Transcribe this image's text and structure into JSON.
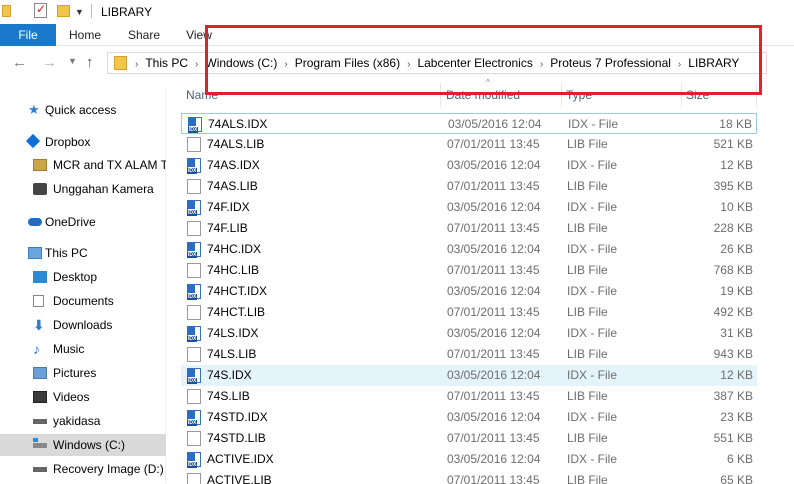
{
  "window": {
    "title": "LIBRARY",
    "quick_access_toolbar": [
      "folder-icon",
      "properties-icon",
      "new-folder-icon",
      "customize-dropdown"
    ]
  },
  "ribbon": {
    "tabs": [
      {
        "label": "File",
        "active": true
      },
      {
        "label": "Home"
      },
      {
        "label": "Share"
      },
      {
        "label": "View"
      }
    ]
  },
  "address_bar": {
    "breadcrumbs": [
      "This PC",
      "Windows (C:)",
      "Program Files (x86)",
      "Labcenter Electronics",
      "Proteus 7 Professional",
      "LIBRARY"
    ],
    "separator": "›"
  },
  "annotation": {
    "color": "#e0202a"
  },
  "nav_pane": {
    "items": [
      {
        "label": "Quick access",
        "icon": "star-icon",
        "indent": 1
      },
      {
        "label": "Dropbox",
        "icon": "dropbox-icon",
        "indent": 1
      },
      {
        "label": "MCR and TX ALAM T",
        "icon": "folder-image-icon",
        "indent": 2
      },
      {
        "label": "Unggahan Kamera",
        "icon": "camera-icon",
        "indent": 2
      },
      {
        "label": "OneDrive",
        "icon": "cloud-icon",
        "indent": 1
      },
      {
        "label": "This PC",
        "icon": "pc-icon",
        "indent": 1
      },
      {
        "label": "Desktop",
        "icon": "desktop-icon",
        "indent": 2
      },
      {
        "label": "Documents",
        "icon": "documents-icon",
        "indent": 2
      },
      {
        "label": "Downloads",
        "icon": "downloads-icon",
        "indent": 2
      },
      {
        "label": "Music",
        "icon": "music-icon",
        "indent": 2
      },
      {
        "label": "Pictures",
        "icon": "pictures-icon",
        "indent": 2
      },
      {
        "label": "Videos",
        "icon": "videos-icon",
        "indent": 2
      },
      {
        "label": "yakidasa",
        "icon": "drive-icon",
        "indent": 2
      },
      {
        "label": "Windows (C:)",
        "icon": "windows-drive-icon",
        "indent": 2,
        "selected": true
      },
      {
        "label": "Recovery Image (D:)",
        "icon": "drive-icon",
        "indent": 2
      }
    ]
  },
  "columns": {
    "name": "Name",
    "date": "Date modified",
    "type": "Type",
    "size": "Size"
  },
  "files": [
    {
      "name": "74ALS.IDX",
      "date": "03/05/2016 12:04",
      "type": "IDX - File",
      "size": "18 KB",
      "kind": "idx",
      "state": "focus"
    },
    {
      "name": "74ALS.LIB",
      "date": "07/01/2011 13:45",
      "type": "LIB File",
      "size": "521 KB",
      "kind": "lib"
    },
    {
      "name": "74AS.IDX",
      "date": "03/05/2016 12:04",
      "type": "IDX - File",
      "size": "12 KB",
      "kind": "idx"
    },
    {
      "name": "74AS.LIB",
      "date": "07/01/2011 13:45",
      "type": "LIB File",
      "size": "395 KB",
      "kind": "lib"
    },
    {
      "name": "74F.IDX",
      "date": "03/05/2016 12:04",
      "type": "IDX - File",
      "size": "10 KB",
      "kind": "idx"
    },
    {
      "name": "74F.LIB",
      "date": "07/01/2011 13:45",
      "type": "LIB File",
      "size": "228 KB",
      "kind": "lib"
    },
    {
      "name": "74HC.IDX",
      "date": "03/05/2016 12:04",
      "type": "IDX - File",
      "size": "26 KB",
      "kind": "idx"
    },
    {
      "name": "74HC.LIB",
      "date": "07/01/2011 13:45",
      "type": "LIB File",
      "size": "768 KB",
      "kind": "lib"
    },
    {
      "name": "74HCT.IDX",
      "date": "03/05/2016 12:04",
      "type": "IDX - File",
      "size": "19 KB",
      "kind": "idx"
    },
    {
      "name": "74HCT.LIB",
      "date": "07/01/2011 13:45",
      "type": "LIB File",
      "size": "492 KB",
      "kind": "lib"
    },
    {
      "name": "74LS.IDX",
      "date": "03/05/2016 12:04",
      "type": "IDX - File",
      "size": "31 KB",
      "kind": "idx"
    },
    {
      "name": "74LS.LIB",
      "date": "07/01/2011 13:45",
      "type": "LIB File",
      "size": "943 KB",
      "kind": "lib"
    },
    {
      "name": "74S.IDX",
      "date": "03/05/2016 12:04",
      "type": "IDX - File",
      "size": "12 KB",
      "kind": "idx",
      "state": "hover"
    },
    {
      "name": "74S.LIB",
      "date": "07/01/2011 13:45",
      "type": "LIB File",
      "size": "387 KB",
      "kind": "lib"
    },
    {
      "name": "74STD.IDX",
      "date": "03/05/2016 12:04",
      "type": "IDX - File",
      "size": "23 KB",
      "kind": "idx"
    },
    {
      "name": "74STD.LIB",
      "date": "07/01/2011 13:45",
      "type": "LIB File",
      "size": "551 KB",
      "kind": "lib"
    },
    {
      "name": "ACTIVE.IDX",
      "date": "03/05/2016 12:04",
      "type": "IDX - File",
      "size": "6 KB",
      "kind": "idx"
    },
    {
      "name": "ACTIVE.LIB",
      "date": "07/01/2011 13:45",
      "type": "LIB File",
      "size": "65 KB",
      "kind": "lib"
    }
  ]
}
